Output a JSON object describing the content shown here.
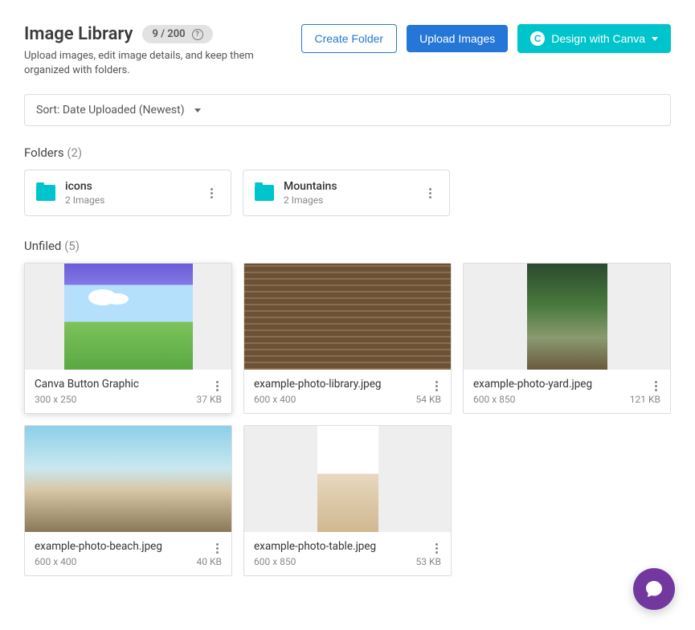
{
  "header": {
    "title": "Image Library",
    "count_text": "9 / 200",
    "subtitle": "Upload images, edit image details, and keep them organized with folders.",
    "create_folder_label": "Create Folder",
    "upload_images_label": "Upload Images",
    "canva_label": "Design with Canva"
  },
  "sort": {
    "label": "Sort: Date Uploaded (Newest)"
  },
  "folders": {
    "title": "Folders",
    "count": "(2)",
    "items": [
      {
        "name": "icons",
        "meta": "2 Images"
      },
      {
        "name": "Mountains",
        "meta": "2 Images"
      }
    ]
  },
  "unfiled": {
    "title": "Unfiled",
    "count": "(5)",
    "items": [
      {
        "name": "Canva Button Graphic",
        "dimensions": "300 x 250",
        "size": "37 KB",
        "canva": true
      },
      {
        "name": "example-photo-library.jpeg",
        "dimensions": "600 x 400",
        "size": "54 KB",
        "canva": false
      },
      {
        "name": "example-photo-yard.jpeg",
        "dimensions": "600 x 850",
        "size": "121 KB",
        "canva": false
      },
      {
        "name": "example-photo-beach.jpeg",
        "dimensions": "600 x 400",
        "size": "40 KB",
        "canva": false
      },
      {
        "name": "example-photo-table.jpeg",
        "dimensions": "600 x 850",
        "size": "53 KB",
        "canva": false
      }
    ]
  }
}
